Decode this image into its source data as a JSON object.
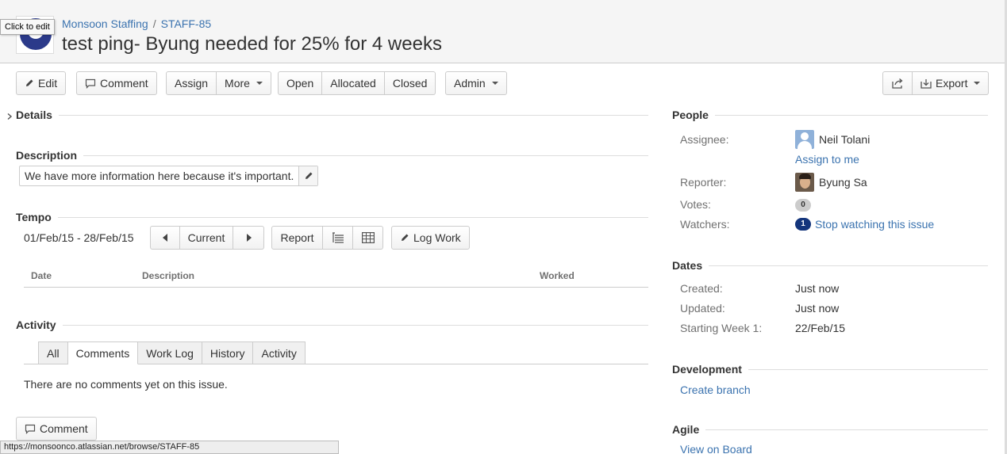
{
  "header": {
    "project_name": "Monsoon Staffing",
    "breadcrumb_sep": "/",
    "issue_key": "STAFF-85",
    "title": "test ping- Byung needed for 25% for 4 weeks",
    "tooltip": "Click to edit"
  },
  "toolbar": {
    "edit": "Edit",
    "comment": "Comment",
    "assign": "Assign",
    "more": "More",
    "open": "Open",
    "allocated": "Allocated",
    "closed": "Closed",
    "admin": "Admin",
    "export": "Export"
  },
  "details": {
    "heading": "Details",
    "toggle_icon": "chevron-right-icon"
  },
  "description": {
    "heading": "Description",
    "text": "We have more information here because it's important."
  },
  "tempo": {
    "heading": "Tempo",
    "date_range": "01/Feb/15 - 28/Feb/15",
    "current": "Current",
    "report": "Report",
    "log_work": "Log Work",
    "columns": [
      "Date",
      "Description",
      "Worked"
    ]
  },
  "activity": {
    "heading": "Activity",
    "tabs": [
      "All",
      "Comments",
      "Work Log",
      "History",
      "Activity"
    ],
    "active_tab": "Comments",
    "empty_message": "There are no comments yet on this issue.",
    "comment_button": "Comment"
  },
  "people": {
    "heading": "People",
    "assignee_label": "Assignee:",
    "assignee": "Neil Tolani",
    "assign_to_me": "Assign to me",
    "reporter_label": "Reporter:",
    "reporter": "Byung Sa",
    "votes_label": "Votes:",
    "votes": "0",
    "watchers_label": "Watchers:",
    "watchers": "1",
    "stop_watching": "Stop watching this issue"
  },
  "dates": {
    "heading": "Dates",
    "created_label": "Created:",
    "created": "Just now",
    "updated_label": "Updated:",
    "updated": "Just now",
    "starting_week_label": "Starting Week 1:",
    "starting_week": "22/Feb/15"
  },
  "development": {
    "heading": "Development",
    "create_branch": "Create branch"
  },
  "agile": {
    "heading": "Agile",
    "view_on_board": "View on Board"
  },
  "status_bar": {
    "url": "https://monsoonco.atlassian.net/browse/STAFF-85"
  },
  "colors": {
    "link": "#3b73af",
    "watch_badge": "#14357c",
    "header_bg": "#f5f5f5"
  }
}
